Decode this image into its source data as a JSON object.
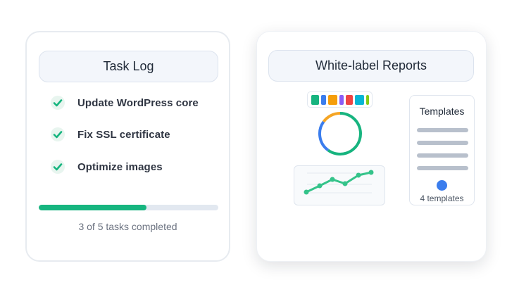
{
  "task_log": {
    "title": "Task Log",
    "tasks": [
      {
        "label": "Update WordPress core",
        "done": true
      },
      {
        "label": "Fix SSL certificate",
        "done": true
      },
      {
        "label": "Optimize images",
        "done": true
      }
    ],
    "progress": 0.6,
    "progress_text": "3 of 5 tasks completed"
  },
  "reports": {
    "title": "White-label Reports",
    "swatches": [
      "#17b47f",
      "#3b7ded",
      "#f59e0b",
      "#8b5cf6",
      "#ef4444",
      "#06b6d4",
      "#84cc16"
    ],
    "donut_segments": [
      {
        "color": "#17b47f",
        "fraction": 0.6
      },
      {
        "color": "#3b7ded",
        "fraction": 0.25
      },
      {
        "color": "#f5a524",
        "fraction": 0.15
      }
    ],
    "trend_color": "#34c38a",
    "templates": {
      "title": "Templates",
      "count_label": "4 templates"
    }
  },
  "colors": {
    "accent_green": "#16b57f",
    "accent_blue": "#3b7ded"
  }
}
